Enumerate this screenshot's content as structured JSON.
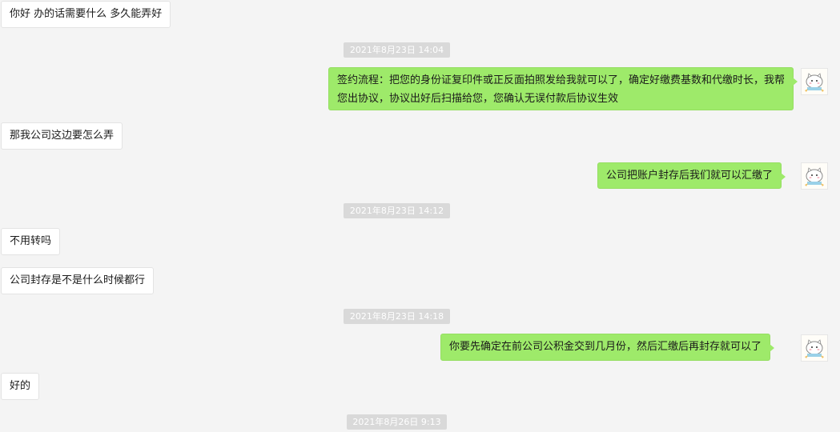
{
  "messages": {
    "m1": "你好  办的话需要什么  多久能弄好",
    "ts1": "2021年8月23日 14:04",
    "m2": "签约流程：把您的身份证复印件或正反面拍照发给我就可以了，确定好缴费基数和代缴时长，我帮您出协议，协议出好后扫描给您，您确认无误付款后协议生效",
    "m3": "那我公司这边要怎么弄",
    "m4": "公司把账户封存后我们就可以汇缴了",
    "ts2": "2021年8月23日 14:12",
    "m5": "不用转吗",
    "m6": "公司封存是不是什么时候都行",
    "ts3": "2021年8月23日 14:18",
    "m7": "你要先确定在前公司公积金交到几月份，然后汇缴后再封存就可以了",
    "m8": "好的",
    "ts4": "2021年8月26日 9:13"
  },
  "colors": {
    "background": "#f4f4f4",
    "outgoing_bubble": "#9eea6a",
    "incoming_bubble": "#ffffff",
    "timestamp_bg": "#d9d9d9"
  },
  "icons": {
    "avatar": "cartoon-cat-avatar-icon"
  }
}
